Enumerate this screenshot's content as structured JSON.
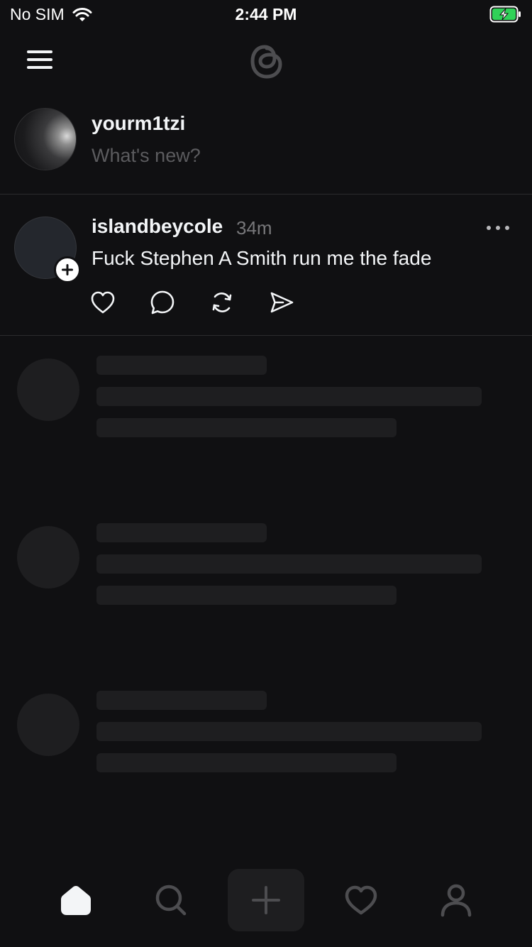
{
  "status_bar": {
    "carrier": "No SIM",
    "time": "2:44 PM",
    "icons": [
      "wifi-icon",
      "battery-charging-icon"
    ],
    "battery_color": "#30d158"
  },
  "header": {
    "menu_icon": "menu-icon",
    "logo_icon": "threads-logo-icon"
  },
  "compose": {
    "username": "yourm1tzi",
    "placeholder": "What's new?"
  },
  "post": {
    "author": "islandbeycole",
    "time": "34m",
    "text": "Fuck Stephen A Smith run me the fade",
    "actions": [
      "like-icon",
      "reply-icon",
      "repost-icon",
      "share-icon"
    ]
  },
  "skeleton_count": 3,
  "bottom_nav": {
    "items": [
      "home-icon",
      "search-icon",
      "create-icon",
      "activity-icon",
      "profile-icon"
    ],
    "active": "home-icon"
  },
  "colors": {
    "background": "#101012",
    "text_primary": "#f3f5f7",
    "text_secondary": "#77777a",
    "placeholder": "#5b5b5e",
    "skeleton": "#1e1e20",
    "divider": "#2b2b2d"
  }
}
